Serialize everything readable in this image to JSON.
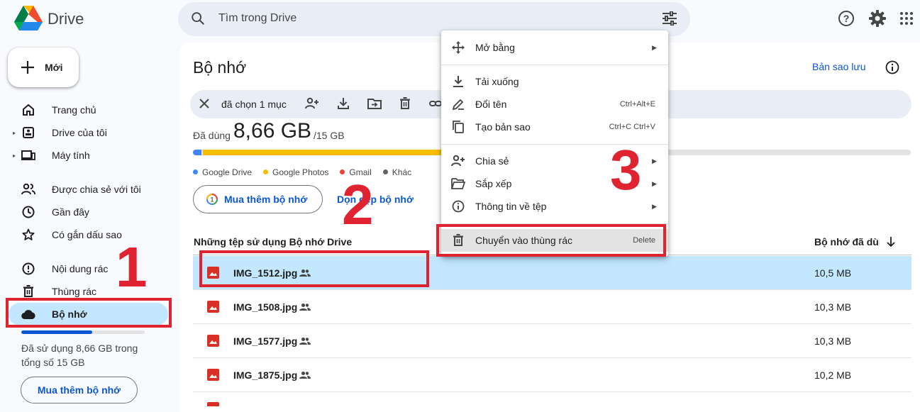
{
  "app": {
    "name": "Drive"
  },
  "search": {
    "placeholder": "Tìm trong Drive"
  },
  "sidebar": {
    "new_label": "Mới",
    "items": [
      {
        "label": "Trang chủ",
        "icon": "home-icon"
      },
      {
        "label": "Drive của tôi",
        "icon": "my-drive-icon"
      },
      {
        "label": "Máy tính",
        "icon": "computer-icon"
      },
      {
        "label": "Được chia sẻ với tôi",
        "icon": "shared-people-icon"
      },
      {
        "label": "Gần đây",
        "icon": "clock-icon"
      },
      {
        "label": "Có gắn dấu sao",
        "icon": "star-icon"
      },
      {
        "label": "Nội dung rác",
        "icon": "spam-icon"
      },
      {
        "label": "Thùng rác",
        "icon": "trash-icon"
      },
      {
        "label": "Bộ nhớ",
        "icon": "cloud-icon"
      }
    ],
    "storage_fraction": 0.577,
    "storage_text": "Đã sử dụng 8,66 GB trong tổng số 15 GB",
    "buy_label": "Mua thêm bộ nhớ"
  },
  "main": {
    "title": "Bộ nhớ",
    "backup_label": "Bản sao lưu",
    "selection": {
      "text": "đã chọn 1 mục"
    },
    "usage": {
      "label": "Đã dùng",
      "value": "8,66 GB",
      "total": "/15 GB"
    },
    "quota_segments": [
      {
        "name": "Google Drive",
        "fraction": 0.012,
        "color": "#4285f4"
      },
      {
        "name": "Google Photos",
        "fraction": 0.563,
        "color": "#fbbc04"
      },
      {
        "name": "Gmail",
        "fraction": 0.001,
        "color": "#ea4335"
      },
      {
        "name": "Khác",
        "fraction": 0.001,
        "color": "#5f6368"
      }
    ],
    "legend": [
      "Google Drive",
      "Google Photos",
      "Gmail",
      "Khác"
    ],
    "buy_label": "Mua thêm bộ nhớ",
    "clean_label": "Dọn dẹp bộ nhớ",
    "columns": {
      "name": "Những tệp sử dụng Bộ nhớ Drive",
      "size": "Bộ nhớ đã dùng"
    },
    "files": [
      {
        "name": "IMG_1512.jpg",
        "size": "10,5 MB",
        "selected": true
      },
      {
        "name": "IMG_1508.jpg",
        "size": "10,3 MB",
        "selected": false
      },
      {
        "name": "IMG_1577.jpg",
        "size": "10,3 MB",
        "selected": false
      },
      {
        "name": "IMG_1875.jpg",
        "size": "10,2 MB",
        "selected": false
      }
    ]
  },
  "context_menu": {
    "items": [
      {
        "label": "Mở bằng",
        "icon": "open-with-icon",
        "shortcut": "",
        "submenu": true
      },
      {
        "label": "Tải xuống",
        "icon": "download-icon",
        "shortcut": "",
        "submenu": false
      },
      {
        "label": "Đổi tên",
        "icon": "rename-icon",
        "shortcut": "Ctrl+Alt+E",
        "submenu": false
      },
      {
        "label": "Tạo bản sao",
        "icon": "copy-icon",
        "shortcut": "Ctrl+C Ctrl+V",
        "submenu": false
      },
      {
        "label": "Chia sẻ",
        "icon": "share-icon",
        "shortcut": "",
        "submenu": true
      },
      {
        "label": "Sắp xếp",
        "icon": "organize-icon",
        "shortcut": "",
        "submenu": true
      },
      {
        "label": "Thông tin về tệp",
        "icon": "file-info-icon",
        "shortcut": "",
        "submenu": true
      },
      {
        "label": "Chuyển vào thùng rác",
        "icon": "trash-icon",
        "shortcut": "Delete",
        "submenu": false
      }
    ]
  },
  "annotations": {
    "step1": "1",
    "step2": "2",
    "step3": "3"
  },
  "colors": {
    "accent": "#0b57d0",
    "selected": "#c2e7ff",
    "annotation": "#e02330"
  }
}
